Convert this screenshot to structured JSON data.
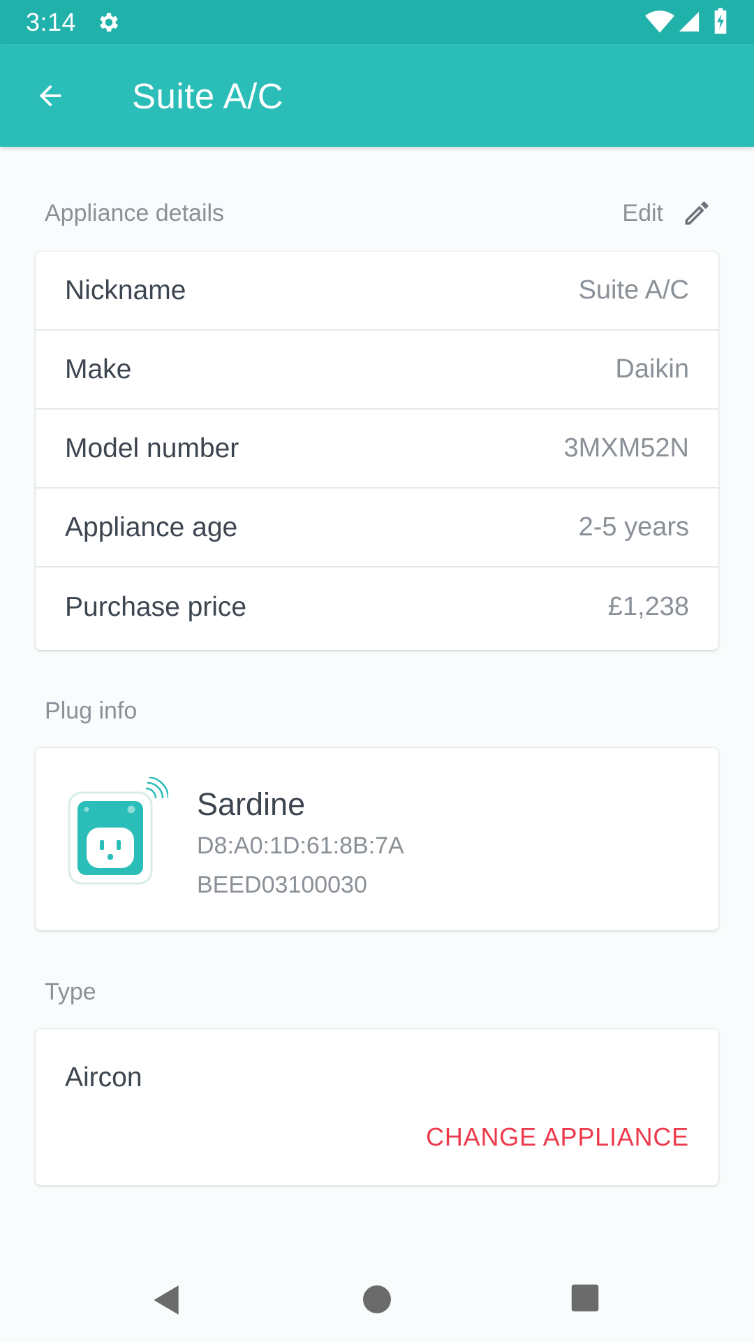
{
  "status_bar": {
    "time": "3:14",
    "icons": [
      "gear-icon",
      "wifi-icon",
      "signal-icon",
      "battery-charging-icon"
    ]
  },
  "app_bar": {
    "title": "Suite A/C",
    "back_icon": "arrow-back-icon"
  },
  "appliance_details": {
    "section_label": "Appliance details",
    "edit_label": "Edit",
    "edit_icon": "pencil-icon",
    "rows": [
      {
        "label": "Nickname",
        "value": "Suite A/C"
      },
      {
        "label": "Make",
        "value": "Daikin"
      },
      {
        "label": "Model number",
        "value": "3MXM52N"
      },
      {
        "label": "Appliance age",
        "value": "2-5 years"
      },
      {
        "label": "Purchase price",
        "value": "£1,238"
      }
    ]
  },
  "plug_info": {
    "section_label": "Plug info",
    "name": "Sardine",
    "mac": "D8:A0:1D:61:8B:7A",
    "serial": "BEED03100030",
    "icon": "smart-plug-icon"
  },
  "type": {
    "section_label": "Type",
    "value": "Aircon",
    "change_label": "CHANGE APPLIANCE"
  },
  "nav_bar": {
    "icons": [
      "nav-back-icon",
      "nav-home-icon",
      "nav-recents-icon"
    ]
  },
  "colors": {
    "status_bar": "#20b1ab",
    "app_bar": "#2bbdb8",
    "accent_red": "#ec3a4c",
    "text_primary": "#3d4550",
    "text_secondary": "#8a9097",
    "background": "#f9fcfc"
  }
}
